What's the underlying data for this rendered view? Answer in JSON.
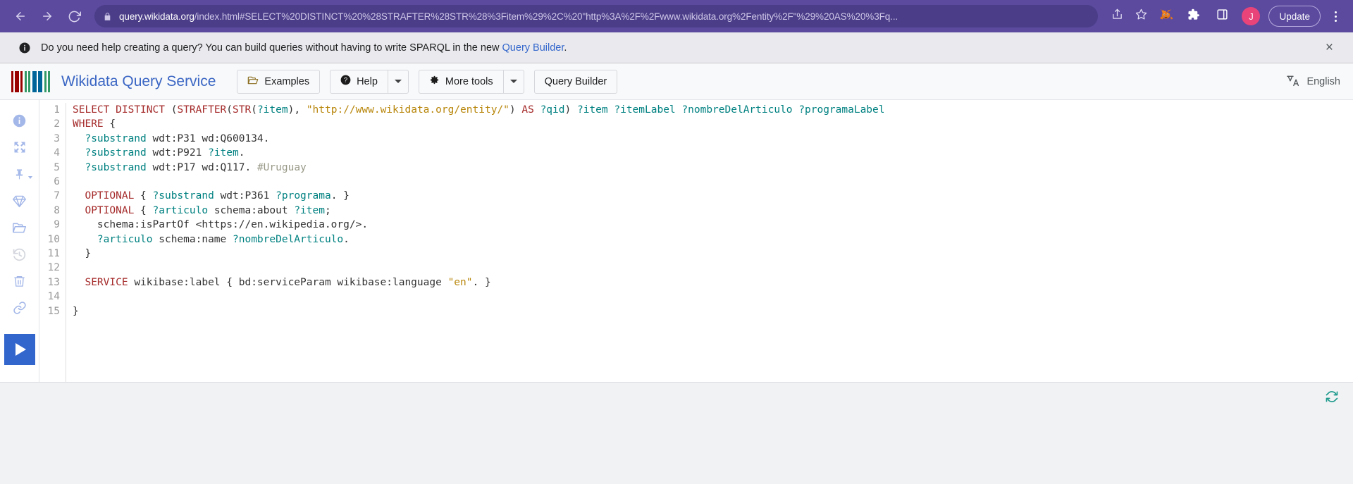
{
  "browser": {
    "back_icon": "arrow-left-icon",
    "forward_icon": "arrow-right-icon",
    "reload_icon": "reload-icon",
    "lock_icon": "lock-icon",
    "url_host": "query.wikidata.org",
    "url_path": "/index.html#SELECT%20DISTINCT%20%28STRAFTER%28STR%28%3Fitem%29%2C%20\"http%3A%2F%2Fwww.wikidata.org%2Fentity%2F\"%29%20AS%20%3Fq...",
    "share_icon": "share-icon",
    "bookmark_icon": "star-icon",
    "extension_metamask_icon": "metamask-fox-icon",
    "extensions_icon": "puzzle-piece-icon",
    "sidepanel_icon": "side-panel-icon",
    "profile_initial": "J",
    "update_label": "Update",
    "menu_icon": "kebab-menu-icon"
  },
  "notification": {
    "icon": "info-circle-icon",
    "text_before": "Do you need help creating a query? You can build queries without having to write SPARQL in the new ",
    "link_label": "Query Builder",
    "text_after": ".",
    "close_label": "×"
  },
  "header": {
    "logo_name": "wikidata-logo",
    "logo_bars": [
      {
        "color": "#990000",
        "width": 3
      },
      {
        "color": "#ffffff",
        "width": 2
      },
      {
        "color": "#990000",
        "width": 6
      },
      {
        "color": "#ffffff",
        "width": 2
      },
      {
        "color": "#990000",
        "width": 3
      },
      {
        "color": "#ffffff",
        "width": 3
      },
      {
        "color": "#339966",
        "width": 3
      },
      {
        "color": "#ffffff",
        "width": 2
      },
      {
        "color": "#339966",
        "width": 3
      },
      {
        "color": "#ffffff",
        "width": 3
      },
      {
        "color": "#006699",
        "width": 6
      },
      {
        "color": "#ffffff",
        "width": 2
      },
      {
        "color": "#006699",
        "width": 6
      },
      {
        "color": "#ffffff",
        "width": 3
      },
      {
        "color": "#339966",
        "width": 3
      },
      {
        "color": "#ffffff",
        "width": 2
      },
      {
        "color": "#339966",
        "width": 3
      }
    ],
    "brand": "Wikidata Query Service",
    "examples_label": "Examples",
    "examples_icon": "folder-open-icon",
    "help_label": "Help",
    "help_icon": "question-circle-icon",
    "more_tools_label": "More tools",
    "more_tools_icon": "gear-icon",
    "query_builder_label": "Query Builder",
    "language_icon": "translate-icon",
    "language_label": "English",
    "brand_color": "#3a66c4"
  },
  "rail": {
    "items": [
      {
        "name": "info-icon",
        "label": "info"
      },
      {
        "name": "expand-icon",
        "label": "full screen"
      },
      {
        "name": "pin-icon",
        "label": "pin",
        "caret": true
      },
      {
        "name": "diamond-icon",
        "label": "prefixes"
      },
      {
        "name": "folder-open-icon",
        "label": "open"
      },
      {
        "name": "history-icon",
        "label": "history",
        "disabled": true
      },
      {
        "name": "trash-icon",
        "label": "clear"
      },
      {
        "name": "link-icon",
        "label": "link"
      }
    ],
    "run_icon": "play-icon",
    "run_color": "#3366cc"
  },
  "editor": {
    "line_numbers": [
      "1",
      "2",
      "3",
      "4",
      "5",
      "6",
      "7",
      "8",
      "9",
      "10",
      "11",
      "12",
      "13",
      "14",
      "15"
    ],
    "lines": [
      "SELECT DISTINCT (STRAFTER(STR(?item), \"http://www.wikidata.org/entity/\") AS ?qid) ?item ?itemLabel ?nombreDelArticulo ?programaLabel",
      "WHERE {",
      "  ?substrand wdt:P31 wd:Q600134.",
      "  ?substrand wdt:P921 ?item.",
      "  ?substrand wdt:P17 wd:Q117. #Uruguay",
      "",
      "  OPTIONAL { ?substrand wdt:P361 ?programa. }",
      "  OPTIONAL { ?articulo schema:about ?item;",
      "    schema:isPartOf <https://en.wikipedia.org/>.",
      "    ?articulo schema:name ?nombreDelArticulo.",
      "  }",
      "",
      "  SERVICE wikibase:label { bd:serviceParam wikibase:language \"en\". }",
      "",
      "}"
    ]
  },
  "footer": {
    "refresh_icon": "refresh-icon",
    "refresh_color": "#1b998b"
  }
}
